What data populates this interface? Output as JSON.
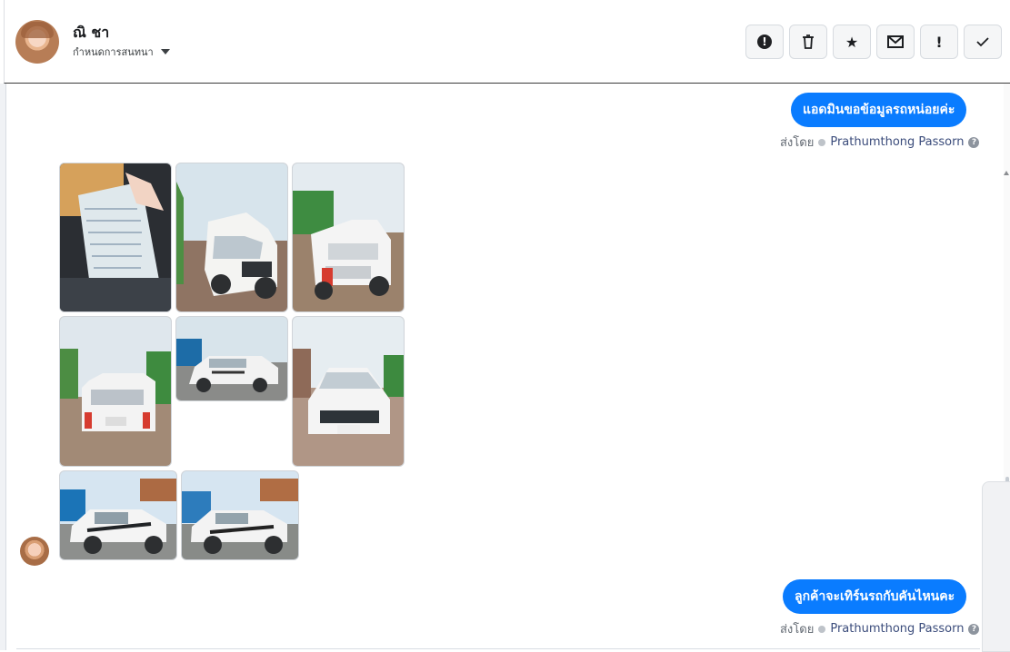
{
  "header": {
    "name": "ณิ ชา",
    "assign_label": "กำหนดการสนทนา",
    "tool_icons": [
      "alert-icon",
      "trash-icon",
      "star-icon",
      "mail-icon",
      "exclamation-icon",
      "check-icon"
    ]
  },
  "messages": [
    {
      "text": "แอดมินขอข้อมูลรถหน่อยค่ะ",
      "sent_by_prefix": "ส่งโดย",
      "sender": "Prathumthong Passorn"
    },
    {
      "text": "ลูกค้าจะเทิร์นรถกับคันไหนคะ",
      "sent_by_prefix": "ส่งโดย",
      "sender": "Prathumthong Passorn"
    }
  ],
  "photos": [
    {
      "label": "document-photo",
      "kind": "document"
    },
    {
      "label": "truck-front-left-photo",
      "kind": "truck"
    },
    {
      "label": "truck-rear-photo",
      "kind": "truck"
    },
    {
      "label": "truck-back-photo",
      "kind": "truck"
    },
    {
      "label": "truck-side-small-photo",
      "kind": "truck"
    },
    {
      "label": "truck-front-photo",
      "kind": "truck"
    },
    {
      "label": "truck-side-1-photo",
      "kind": "truck"
    },
    {
      "label": "truck-side-2-photo",
      "kind": "truck"
    }
  ],
  "colors": {
    "bubble": "#0a7cff",
    "link": "#3b4c7b",
    "muted": "#606770"
  }
}
